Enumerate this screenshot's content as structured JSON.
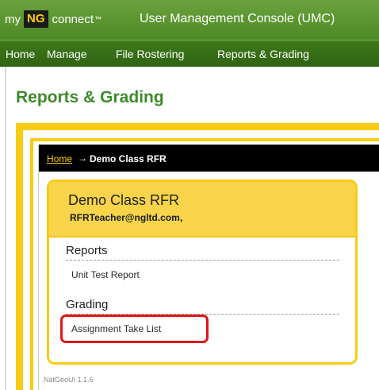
{
  "header": {
    "brand_my": "my",
    "brand_ng": "NG",
    "brand_connect": "connect",
    "brand_tm": "™",
    "app_title": "User Management Console (UMC)"
  },
  "nav": {
    "items": [
      {
        "label": "Home"
      },
      {
        "label": "Manage"
      },
      {
        "label": "File Rostering"
      },
      {
        "label": "Reports & Grading"
      }
    ]
  },
  "page": {
    "title": "Reports & Grading"
  },
  "breadcrumb": {
    "home": "Home",
    "separator": "→",
    "current": "Demo Class RFR"
  },
  "class_card": {
    "name": "Demo Class RFR",
    "teacher": "RFRTeacher@ngltd.com,",
    "reports_heading": "Reports",
    "reports_links": [
      "Unit Test Report"
    ],
    "grading_heading": "Grading",
    "grading_links": [
      "Assignment Take List"
    ]
  },
  "footer": {
    "version": "NatGeoUI 1.1.6"
  },
  "colors": {
    "header_green": "#5a9630",
    "nav_green": "#35691a",
    "title_green": "#3e8a2a",
    "yellow": "#f7cc15",
    "highlight_red": "#e0161b"
  }
}
